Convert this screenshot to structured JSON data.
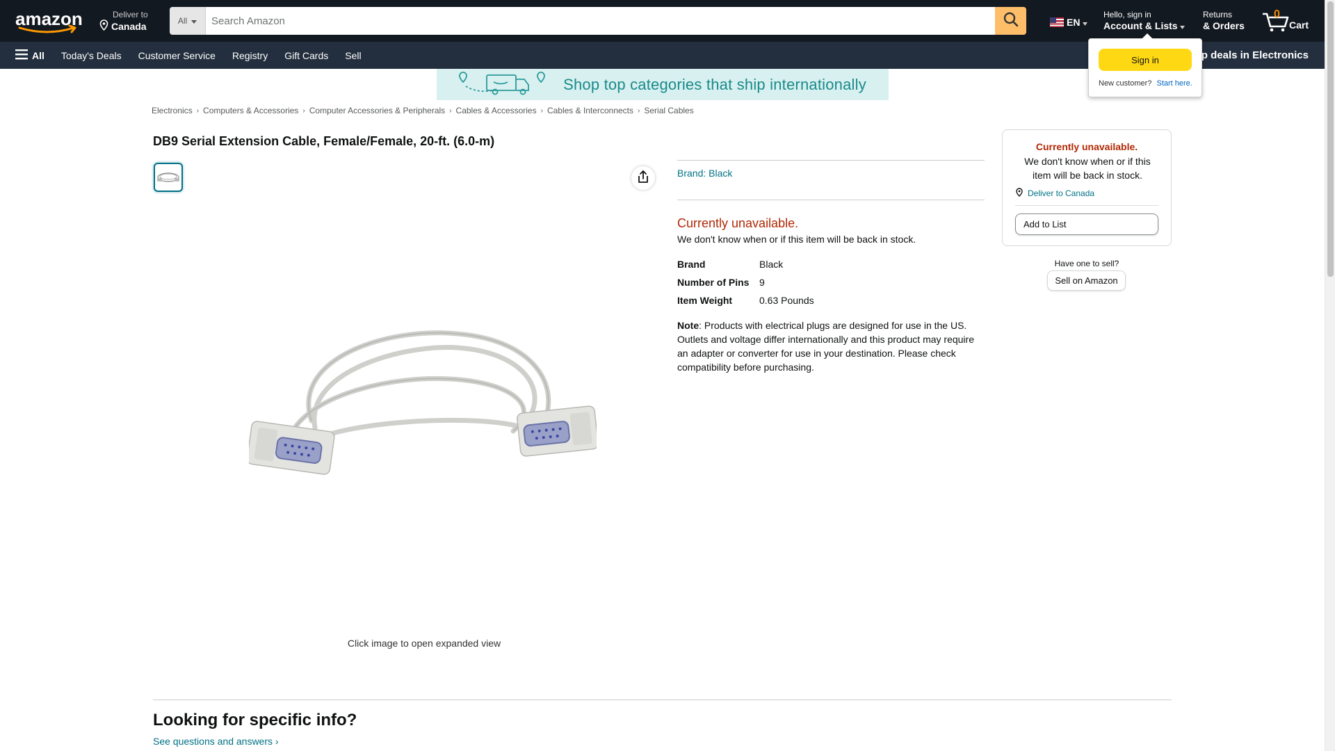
{
  "header": {
    "logo_text": "amazon",
    "deliver_small": "Deliver to",
    "deliver_big": "Canada",
    "search_category": "All",
    "search_placeholder": "Search Amazon",
    "language": "EN",
    "account_small": "Hello, sign in",
    "account_big": "Account & Lists",
    "returns_small": "Returns",
    "returns_big": "& Orders",
    "cart_count": "0",
    "cart_label": "Cart"
  },
  "subnav": {
    "all_label": "All",
    "links": [
      "Today's Deals",
      "Customer Service",
      "Registry",
      "Gift Cards",
      "Sell"
    ],
    "deal_text": "op deals in Electronics"
  },
  "signin_flyout": {
    "button": "Sign in",
    "new_customer": "New customer?",
    "start_here": "Start here."
  },
  "banner": {
    "text": "Shop top categories that ship internationally"
  },
  "breadcrumb": [
    "Electronics",
    "Computers & Accessories",
    "Computer Accessories & Peripherals",
    "Cables & Accessories",
    "Cables & Interconnects",
    "Serial Cables"
  ],
  "product": {
    "title": "DB9 Serial Extension Cable, Female/Female, 20-ft. (6.0-m)",
    "image_caption": "Click image to open expanded view",
    "brand_link": "Brand: Black",
    "unavailable": "Currently unavailable.",
    "unavailable_sub": "We don't know when or if this item will be back in stock.",
    "specs": [
      {
        "key": "Brand",
        "value": "Black"
      },
      {
        "key": "Number of Pins",
        "value": "9"
      },
      {
        "key": "Item Weight",
        "value": "0.63 Pounds"
      }
    ],
    "note_label": "Note",
    "note_text": ": Products with electrical plugs are designed for use in the US. Outlets and voltage differ internationally and this product may require an adapter or converter for use in your destination. Please check compatibility before purchasing."
  },
  "buybox": {
    "unavailable": "Currently unavailable.",
    "sub": "We don't know when or if this item will be back in stock.",
    "deliver": "Deliver to Canada",
    "add_to_list": "Add to List",
    "have_one": "Have one to sell?",
    "sell_button": "Sell on Amazon"
  },
  "bottom": {
    "heading": "Looking for specific info?",
    "qa_link": "See questions and answers"
  },
  "colors": {
    "nav_dark": "#131921",
    "nav_sub": "#232f3e",
    "search_button": "#febd69",
    "signin_button": "#ffd814",
    "link": "#007185",
    "unavailable": "#b12704"
  }
}
